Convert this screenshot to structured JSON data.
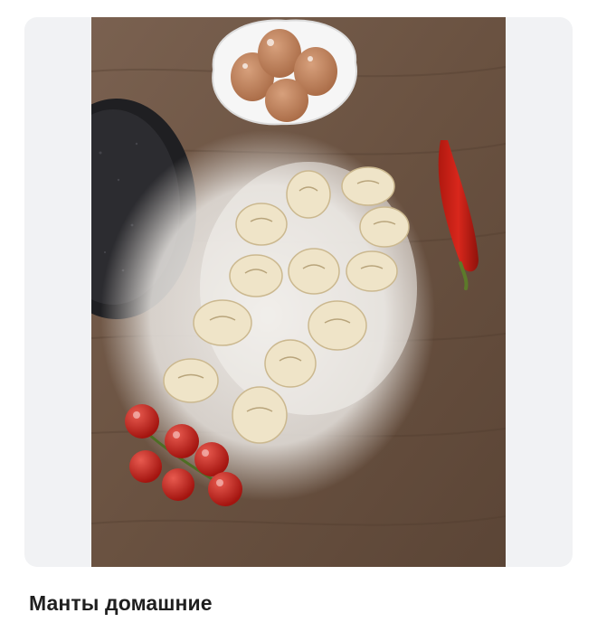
{
  "recipe": {
    "title": "Манты домашние"
  },
  "photo": {
    "icon": "food-photo"
  },
  "colors": {
    "card_background": "#f1f2f4",
    "title": "#1f1f1f",
    "page_background": "#ffffff"
  }
}
